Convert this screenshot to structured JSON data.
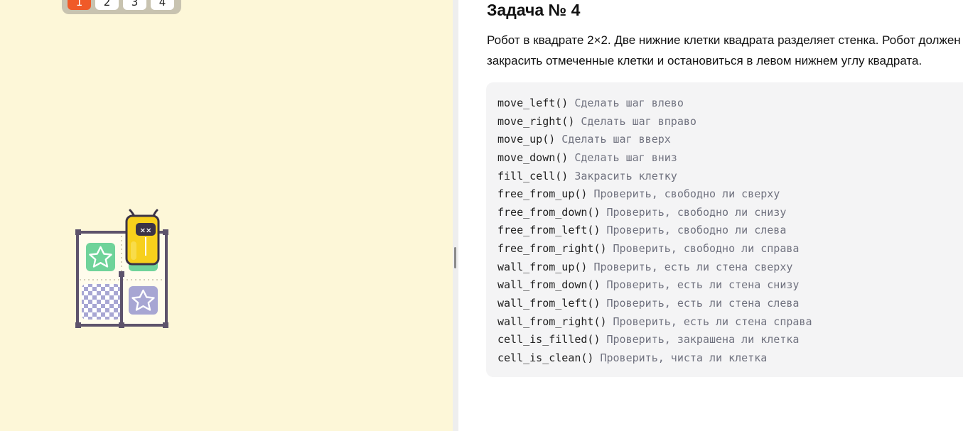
{
  "task_tabs": [
    {
      "label": "1",
      "active": true
    },
    {
      "label": "2",
      "active": false
    },
    {
      "label": "3",
      "active": false
    },
    {
      "label": "4",
      "active": false
    }
  ],
  "task": {
    "title": "Задача № 4",
    "description_line1": "Робот в квадрате 2×2. Две нижние клетки квадрата разделяет стенка. Робот должен",
    "description_line2": "закрасить отмеченные клетки и остановиться в левом нижнем углу квадрата."
  },
  "commands": [
    {
      "code": "move_left()",
      "comment": "Сделать шаг влево"
    },
    {
      "code": "move_right()",
      "comment": "Сделать шаг вправо"
    },
    {
      "code": "move_up()",
      "comment": "Сделать шаг вверх"
    },
    {
      "code": "move_down()",
      "comment": "Сделать шаг вниз"
    },
    {
      "code": "fill_cell()",
      "comment": "Закрасить клетку"
    },
    {
      "code": "free_from_up()",
      "comment": "Проверить, свободно ли сверху"
    },
    {
      "code": "free_from_down()",
      "comment": "Проверить, свободно ли снизу"
    },
    {
      "code": "free_from_left()",
      "comment": "Проверить, свободно ли слева"
    },
    {
      "code": "free_from_right()",
      "comment": "Проверить, свободно ли справа"
    },
    {
      "code": "wall_from_up()",
      "comment": "Проверить, есть ли стена сверху"
    },
    {
      "code": "wall_from_down()",
      "comment": "Проверить, есть ли стена снизу"
    },
    {
      "code": "wall_from_left()",
      "comment": "Проверить, есть ли стена слева"
    },
    {
      "code": "wall_from_right()",
      "comment": "Проверить, есть ли стена справа"
    },
    {
      "code": "cell_is_filled()",
      "comment": "Проверить, закрашена ли клетка"
    },
    {
      "code": "cell_is_clean()",
      "comment": "Проверить, чиста ли клетка"
    }
  ],
  "colors": {
    "left_background": "#fdf7d8",
    "active_tab": "#f05a28",
    "filled_target": "#6fd39a",
    "clean_target": "#a7a6d3",
    "robot": "#f7d01c",
    "wall": "#5d536c",
    "comment_text": "#70727f",
    "code_block_bg": "#f4f4f5"
  },
  "icons": [
    "star-icon",
    "robot-icon",
    "checkered-cell-icon"
  ]
}
